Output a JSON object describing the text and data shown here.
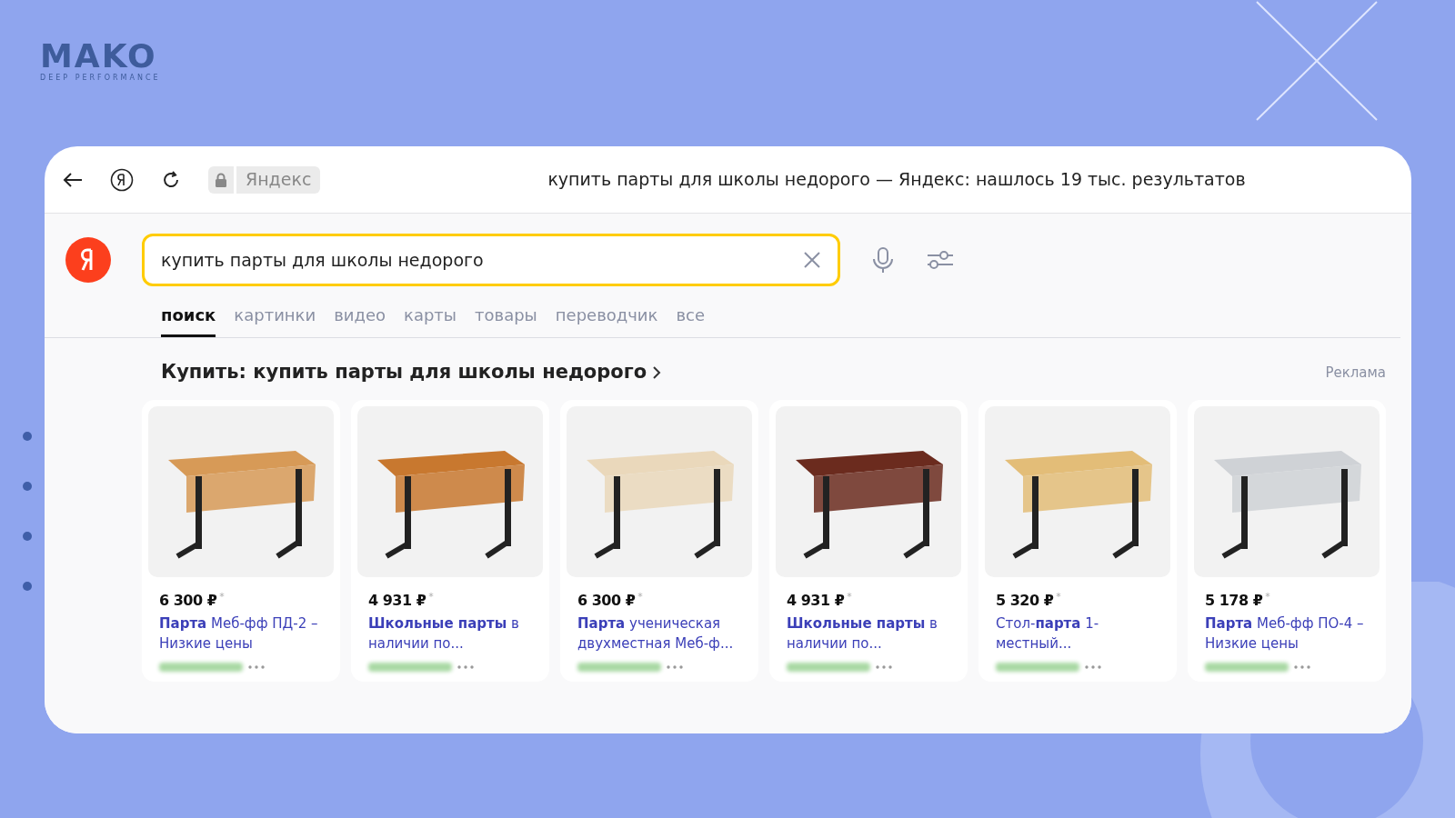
{
  "brand": {
    "name": "MAKO",
    "tagline": "DEEP PERFORMANCE"
  },
  "browser": {
    "site_chip": "Яндекс",
    "page_title": "купить парты для школы недорого — Яндекс: нашлось 19 тыс. результатов"
  },
  "search": {
    "value": "купить парты для школы недорого"
  },
  "tabs": [
    {
      "label": "поиск",
      "selected": true
    },
    {
      "label": "картинки",
      "selected": false
    },
    {
      "label": "видео",
      "selected": false
    },
    {
      "label": "карты",
      "selected": false
    },
    {
      "label": "товары",
      "selected": false
    },
    {
      "label": "переводчик",
      "selected": false
    },
    {
      "label": "все",
      "selected": false
    }
  ],
  "shopping": {
    "heading": "Купить: купить парты для школы недорого",
    "ad_label": "Реклама",
    "products": [
      {
        "price": "6 300 ₽",
        "mark": "*",
        "title": "**Парта** Меб-фф ПД-2 – Низкие цены",
        "color": "#d79a57"
      },
      {
        "price": "4 931 ₽",
        "mark": "*",
        "title": "**Школьные парты** в наличии по...",
        "color": "#c8782f"
      },
      {
        "price": "6 300 ₽",
        "mark": "*",
        "title": "**Парта** ученическая двухместная Меб-ф...",
        "color": "#ead8bb"
      },
      {
        "price": "4 931 ₽",
        "mark": "*",
        "title": "**Школьные парты** в наличии по...",
        "color": "#6b2b1e"
      },
      {
        "price": "5 320 ₽",
        "mark": "*",
        "title": "Стол-**парта** 1-местный...",
        "color": "#e3bd78"
      },
      {
        "price": "5 178 ₽",
        "mark": "*",
        "title": "**Парта** Меб-фф ПО-4 – Низкие цены",
        "color": "#cfd2d6"
      }
    ]
  }
}
